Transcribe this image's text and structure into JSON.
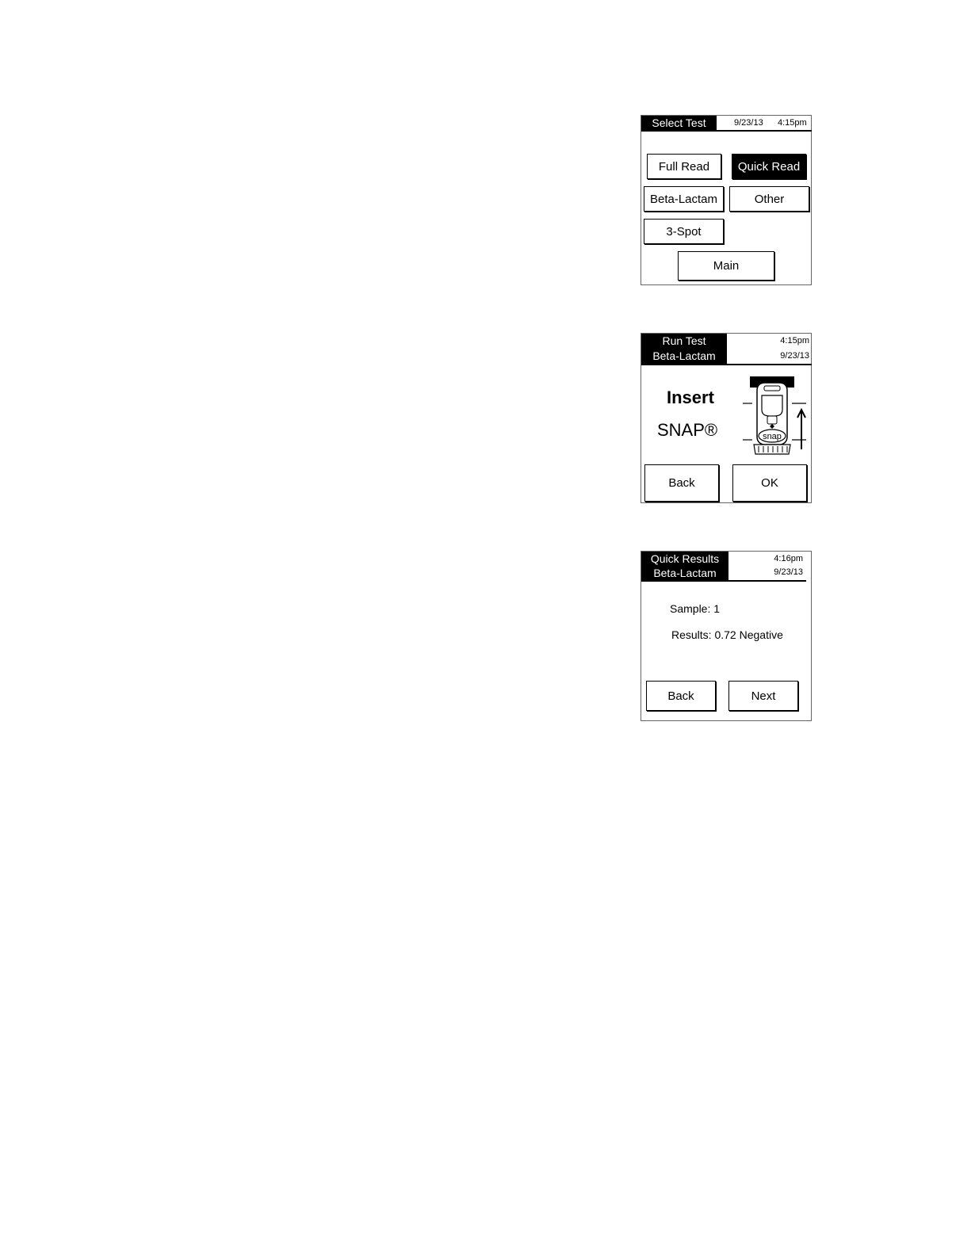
{
  "screens": {
    "select_test": {
      "title": "Select Test",
      "date": "9/23/13",
      "time": "4:15pm",
      "buttons": {
        "full_read": "Full Read",
        "quick_read": "Quick Read",
        "beta_lactam": "Beta-Lactam",
        "other": "Other",
        "three_spot": "3-Spot",
        "main": "Main"
      },
      "selected": "Quick Read"
    },
    "run_test": {
      "title_line1": "Run Test",
      "title_line2": "Beta-Lactam",
      "time": "4:15pm",
      "date": "9/23/13",
      "instruction_line1": "Insert",
      "instruction_line2": "SNAP®",
      "device_icon": "snap-device-insert-icon",
      "device_label": "snap",
      "buttons": {
        "back": "Back",
        "ok": "OK"
      }
    },
    "quick_results": {
      "title_line1": "Quick Results",
      "title_line2": "Beta-Lactam",
      "time": "4:16pm",
      "date": "9/23/13",
      "sample_text": "Sample: 1",
      "results_text": "Results: 0.72 Negative",
      "buttons": {
        "back": "Back",
        "next": "Next"
      }
    }
  }
}
